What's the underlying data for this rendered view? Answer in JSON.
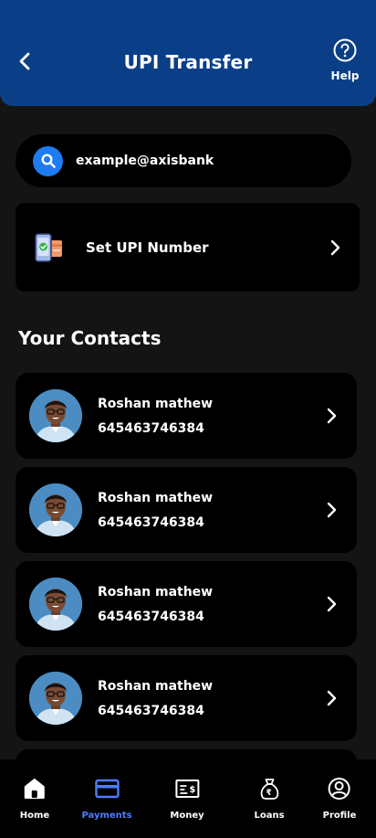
{
  "header": {
    "title": "UPI Transfer",
    "help_label": "Help"
  },
  "search": {
    "value": "example@axisbank"
  },
  "upi_number": {
    "label": "Set UPI Number"
  },
  "contacts_section": {
    "title": "Your Contacts"
  },
  "contacts": [
    {
      "name": "Roshan mathew",
      "number": "645463746384"
    },
    {
      "name": "Roshan mathew",
      "number": "645463746384"
    },
    {
      "name": "Roshan mathew",
      "number": "645463746384"
    },
    {
      "name": "Roshan mathew",
      "number": "645463746384"
    }
  ],
  "bottom_nav": {
    "items": [
      {
        "label": "Home",
        "icon": "home-icon",
        "active": false
      },
      {
        "label": "Payments",
        "icon": "card-icon",
        "active": true
      },
      {
        "label": "Money",
        "icon": "cheque-icon",
        "active": false
      },
      {
        "label": "Loans",
        "icon": "money-bag-icon",
        "active": false
      },
      {
        "label": "Profile",
        "icon": "user-circle-icon",
        "active": false
      }
    ]
  },
  "colors": {
    "header_bg": "#0a3f87",
    "page_bg": "#141414",
    "card_bg": "#000000",
    "accent": "#4a7dff",
    "search_icon_bg": "#1e7bf0"
  }
}
